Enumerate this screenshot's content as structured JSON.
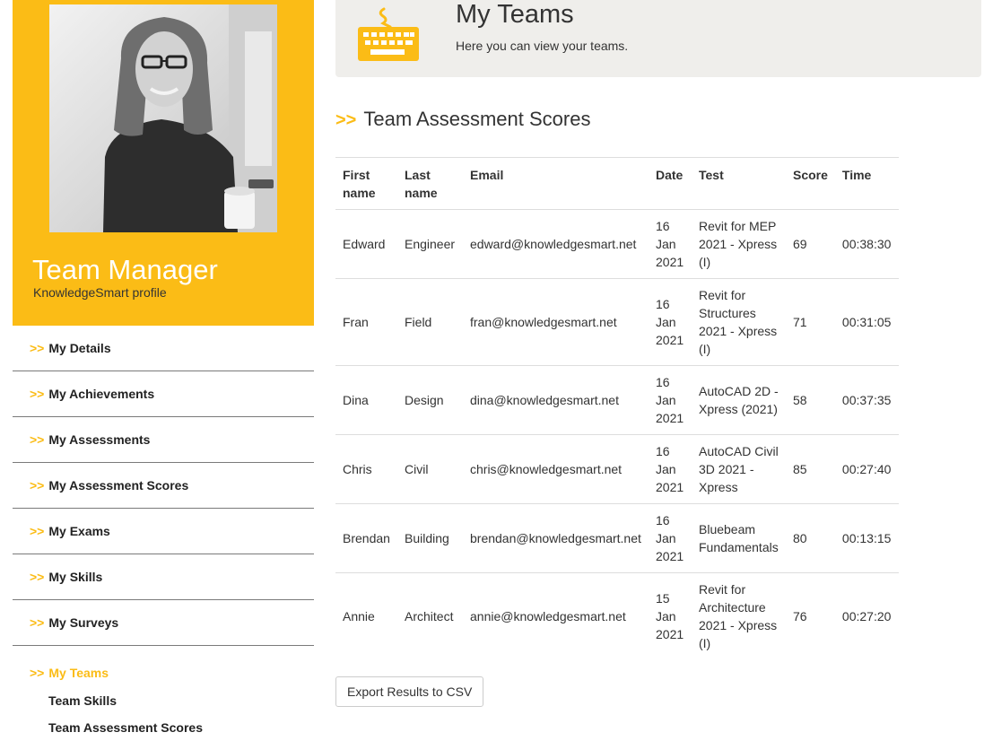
{
  "profile": {
    "name": "Team Manager",
    "subtitle": "KnowledgeSmart profile"
  },
  "nav": {
    "prefix": ">>",
    "items": [
      {
        "label": "My Details"
      },
      {
        "label": "My Achievements"
      },
      {
        "label": "My Assessments"
      },
      {
        "label": "My Assessment Scores"
      },
      {
        "label": "My Exams"
      },
      {
        "label": "My Skills"
      },
      {
        "label": "My Surveys"
      }
    ],
    "active": {
      "label": "My Teams"
    },
    "sub_items": [
      {
        "label": "Team Skills"
      },
      {
        "label": "Team Assessment Scores"
      }
    ]
  },
  "banner": {
    "title": "My Teams",
    "subtitle": "Here you can view your teams.",
    "icon": "keyboard-icon"
  },
  "section": {
    "prefix": ">>",
    "title": "Team Assessment Scores"
  },
  "table": {
    "headers": {
      "first": [
        "First",
        "name"
      ],
      "last": [
        "Last",
        "name"
      ],
      "email": "Email",
      "date": "Date",
      "test": "Test",
      "score": "Score",
      "time": "Time"
    },
    "rows": [
      {
        "first": "Edward",
        "last": "Engineer",
        "email": "edward@knowledgesmart.net",
        "date": [
          "16",
          "Jan",
          "2021"
        ],
        "test": [
          "Revit for MEP",
          "2021 - Xpress",
          "(I)"
        ],
        "score": "69",
        "time": "00:38:30"
      },
      {
        "first": "Fran",
        "last": "Field",
        "email": "fran@knowledgesmart.net",
        "date": [
          "16",
          "Jan",
          "2021"
        ],
        "test": [
          "Revit for",
          "Structures",
          "2021 - Xpress",
          "(I)"
        ],
        "score": "71",
        "time": "00:31:05"
      },
      {
        "first": "Dina",
        "last": "Design",
        "email": "dina@knowledgesmart.net",
        "date": [
          "16",
          "Jan",
          "2021"
        ],
        "test": [
          "AutoCAD 2D -",
          "Xpress (2021)"
        ],
        "score": "58",
        "time": "00:37:35"
      },
      {
        "first": "Chris",
        "last": "Civil",
        "email": "chris@knowledgesmart.net",
        "date": [
          "16",
          "Jan",
          "2021"
        ],
        "test": [
          "AutoCAD Civil",
          "3D 2021 -",
          "Xpress"
        ],
        "score": "85",
        "time": "00:27:40"
      },
      {
        "first": "Brendan",
        "last": "Building",
        "email": "brendan@knowledgesmart.net",
        "date": [
          "16",
          "Jan",
          "2021"
        ],
        "test": [
          "Bluebeam",
          "Fundamentals"
        ],
        "score": "80",
        "time": "00:13:15"
      },
      {
        "first": "Annie",
        "last": "Architect",
        "email": "annie@knowledgesmart.net",
        "date": [
          "15",
          "Jan",
          "2021"
        ],
        "test": [
          "Revit for",
          "Architecture",
          "2021 - Xpress",
          "(I)"
        ],
        "score": "76",
        "time": "00:27:20"
      }
    ]
  },
  "export_button": {
    "label": "Export Results to CSV"
  },
  "colors": {
    "accent": "#fbbc16",
    "banner_bg": "#efeeeb",
    "text": "#333333"
  }
}
